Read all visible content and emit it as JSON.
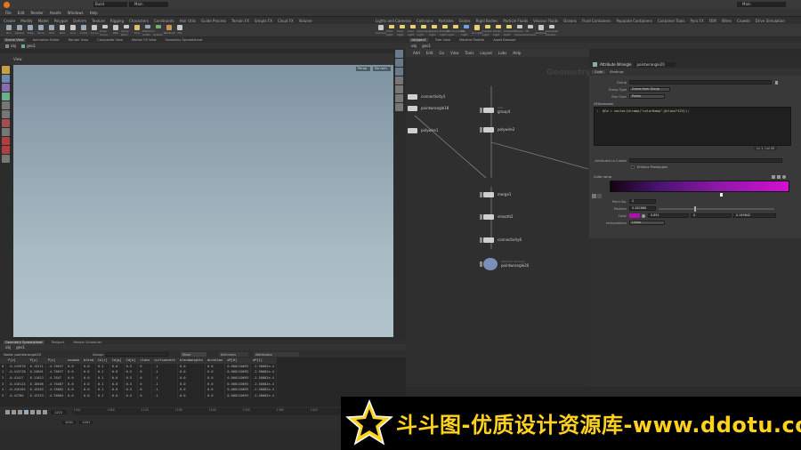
{
  "top": {
    "build": "Build",
    "desktop": "Main",
    "right_desktop": "Main"
  },
  "menu": [
    "File",
    "Edit",
    "Render",
    "Assets",
    "Windows",
    "Help"
  ],
  "left_shelf_tabs": [
    "Create",
    "Modify",
    "Model",
    "Polygon",
    "Deform",
    "Texture",
    "Rigging",
    "Characters",
    "Constraints",
    "Hair Utils",
    "Guide Process",
    "Terrain FX",
    "Simple FX",
    "Cloud FX",
    "Volume"
  ],
  "left_tools": [
    {
      "label": "Box",
      "color": "#9aa8b8"
    },
    {
      "label": "Sphere",
      "color": "#9aa8b8"
    },
    {
      "label": "Tube",
      "color": "#9aa8b8"
    },
    {
      "label": "Torus",
      "color": "#9aa8b8"
    },
    {
      "label": "Grid",
      "color": "#9aa8b8"
    },
    {
      "label": "Null",
      "color": "#c8c8c8"
    },
    {
      "label": "Line",
      "color": "#c8c8c8"
    },
    {
      "label": "Circle",
      "color": "#9aa8b8"
    },
    {
      "label": "Curve",
      "color": "#c8c8c8"
    },
    {
      "label": "Draw Curve",
      "color": "#c8c8c8"
    },
    {
      "label": "Path",
      "color": "#c8c8c8"
    },
    {
      "label": "Spray Paint",
      "color": "#c8c8c8"
    },
    {
      "label": "Font",
      "color": "#d8c070"
    },
    {
      "label": "Platonic Solids",
      "color": "#9aa8b8"
    },
    {
      "label": "L-System",
      "color": "#70b070"
    },
    {
      "label": "Metaball",
      "color": "#d09050"
    },
    {
      "label": "File",
      "color": "#c8c8c8"
    }
  ],
  "right_shelf_tabs": [
    "Lights and Cameras",
    "Collisions",
    "Particles",
    "Grains",
    "Rigid Bodies",
    "Particle Fluids",
    "Viscous Fluids",
    "Oceans",
    "Fluid Containers",
    "Populate Containers",
    "Container Tools",
    "Pyro FX",
    "FEM",
    "Wires",
    "Crowds",
    "Drive Simulation"
  ],
  "right_tools": [
    {
      "label": "Camera",
      "color": "#c8c8c8"
    },
    {
      "label": "Point Light",
      "color": "#e8d070"
    },
    {
      "label": "Spot Light",
      "color": "#e8d070"
    },
    {
      "label": "Area Light",
      "color": "#e8d070"
    },
    {
      "label": "Geometry Light",
      "color": "#e8d070"
    },
    {
      "label": "Volume Light",
      "color": "#e8d070"
    },
    {
      "label": "Distant Light",
      "color": "#e8d070"
    },
    {
      "label": "Environment Light",
      "color": "#e8d070"
    },
    {
      "label": "Sky Light",
      "color": "#70a0e0"
    },
    {
      "label": "GI Light",
      "color": "#e8d070"
    },
    {
      "label": "Caustic Light",
      "color": "#e8d070"
    },
    {
      "label": "Portal Light",
      "color": "#e8d070"
    },
    {
      "label": "Ambient Light",
      "color": "#e8d070"
    },
    {
      "label": "Stereo Camera",
      "color": "#c8c8c8"
    },
    {
      "label": "VR Camera",
      "color": "#c8c8c8"
    },
    {
      "label": "Switcher",
      "color": "#c8c8c8"
    },
    {
      "label": "Gamepad Camera",
      "color": "#c8c8c8"
    }
  ],
  "left_pane_tabs": [
    "Scene View",
    "Animation Editor",
    "Render View",
    "Composite View",
    "Motion FX View",
    "Geometry Spreadsheet"
  ],
  "vp": {
    "path": "obj",
    "node": "geo1",
    "label": "View",
    "persp": "Persp",
    "cam": "No cam"
  },
  "node_tabs": [
    "/obj/geo1",
    "Tree View",
    "Material Palette",
    "Asset Browser"
  ],
  "node_menu": [
    "Add",
    "Edit",
    "Go",
    "View",
    "Tools",
    "Layout",
    "Labs",
    "Help"
  ],
  "node_path": {
    "root": "obj",
    "node": "geo1"
  },
  "node_watermark": "Geometry",
  "nodes": [
    {
      "name": "connectivity4",
      "sub": "",
      "kind": "side"
    },
    {
      "name": "pointwrangle18",
      "sub": "",
      "kind": "side"
    },
    {
      "name": "polywire1",
      "sub": "",
      "kind": "side"
    },
    {
      "name": "group4",
      "sub": "Line",
      "kind": "main"
    },
    {
      "name": "polywire2",
      "sub": "",
      "kind": "main"
    },
    {
      "name": "merge1",
      "sub": "",
      "kind": "main"
    },
    {
      "name": "smooth2",
      "sub": "",
      "kind": "main"
    },
    {
      "name": "connectivity6",
      "sub": "",
      "kind": "main"
    },
    {
      "name": "pointwrangle20",
      "sub": "Attribute Wrangle",
      "kind": "sel"
    }
  ],
  "parm": {
    "header_type": "Attribute Wrangle",
    "header_name": "pointwrangle20",
    "tabs": [
      "Code",
      "Bindings"
    ],
    "group_label": "Group",
    "group_type_label": "Group Type",
    "group_type_value": "Guess from Group",
    "run_over_label": "Run Over",
    "run_over_value": "Points",
    "vex_label": "VEXpression",
    "code": "@Cd = vector(chramp(\"colorRamp\",@class*123));",
    "line_info": "Ln 1, Col 49",
    "attr_create_label": "Attributes to Create",
    "enforce_label": "Enforce Prototypes",
    "ramp_title": "Color ramp",
    "point_no_label": "Point No.",
    "point_no_value": "2",
    "position_label": "Position",
    "position_value": "0.282686",
    "color_label": "Color",
    "color_v1": "0.891",
    "color_v2": "0",
    "color_v3": "0.149642",
    "interp_label": "Interpolation",
    "interp_value": "Linear"
  },
  "sheet": {
    "tabs": [
      "Geometry Spreadsheet",
      "Textport",
      "Render Scheduler"
    ],
    "path_root": "obj",
    "path_node": "geo1",
    "node_label": "Node: pointwrangle20",
    "group_label": "Group:",
    "view_label": "View",
    "intrinsics_label": "Intrinsics",
    "attribs_label": "Attributes",
    "headers": [
      "",
      "P[x]",
      "P[y]",
      "P[z]",
      "uvwave",
      "blend",
      "Cd[r]",
      "Cd[g]",
      "Cd[b]",
      "class",
      "curlconnect",
      "blendweights",
      "duration",
      "dP[0]",
      "dP[1]"
    ],
    "rows": [
      [
        "0",
        "-0.415978",
        "0.15211",
        "-4.76637",
        "0.0",
        "0.0",
        "0.1",
        "0.0",
        "0.5",
        "0",
        "-1",
        "0.0",
        "0.0",
        "0.000110693",
        "-2.50082e-4"
      ],
      [
        "1",
        "-0.415728",
        "0.24661",
        "-4.76637",
        "0.0",
        "0.0",
        "0.1",
        "0.0",
        "0.5",
        "0",
        "-1",
        "0.0",
        "0.0",
        "0.000110693",
        "-2.50082e-4"
      ],
      [
        "2",
        "-0.41417",
        "0.11013",
        "-4.7647",
        "0.0",
        "0.0",
        "0.1",
        "0.0",
        "0.5",
        "0",
        "-1",
        "0.0",
        "0.0",
        "0.000110693",
        "-2.50082e-4"
      ],
      [
        "3",
        "-0.416124",
        "0.10506",
        "-4.76487",
        "0.0",
        "0.0",
        "0.1",
        "0.0",
        "0.5",
        "0",
        "-1",
        "0.0",
        "0.0",
        "0.000110693",
        "-2.50082e-4"
      ],
      [
        "4",
        "-0.416162",
        "0.15263",
        "-4.76602",
        "0.0",
        "0.0",
        "0.1",
        "0.0",
        "0.5",
        "0",
        "-1",
        "0.0",
        "0.0",
        "0.000110693",
        "-2.50082e-4"
      ],
      [
        "5",
        "-0.41700",
        "0.13153",
        "-4.76604",
        "0.0",
        "0.0",
        "0.1",
        "0.0",
        "0.5",
        "0",
        "-1",
        "0.0",
        "0.0",
        "0.000110693",
        "-2.50082e-4"
      ]
    ]
  },
  "timeline": {
    "frame": "1221",
    "start": "1001",
    "end": "1001",
    "ticks": [
      "1001",
      "1060",
      "1120",
      "1180",
      "1240",
      "1300",
      "1360",
      "1420",
      "1480",
      "1540"
    ]
  },
  "banner": {
    "text": "斗斗图-优质设计资源库-www.ddotu.com",
    "accent": "#ffd21e"
  },
  "colors": {
    "branch": "#5a1e6e",
    "ramp_start": "#140414",
    "ramp_end": "#d40fd0"
  }
}
